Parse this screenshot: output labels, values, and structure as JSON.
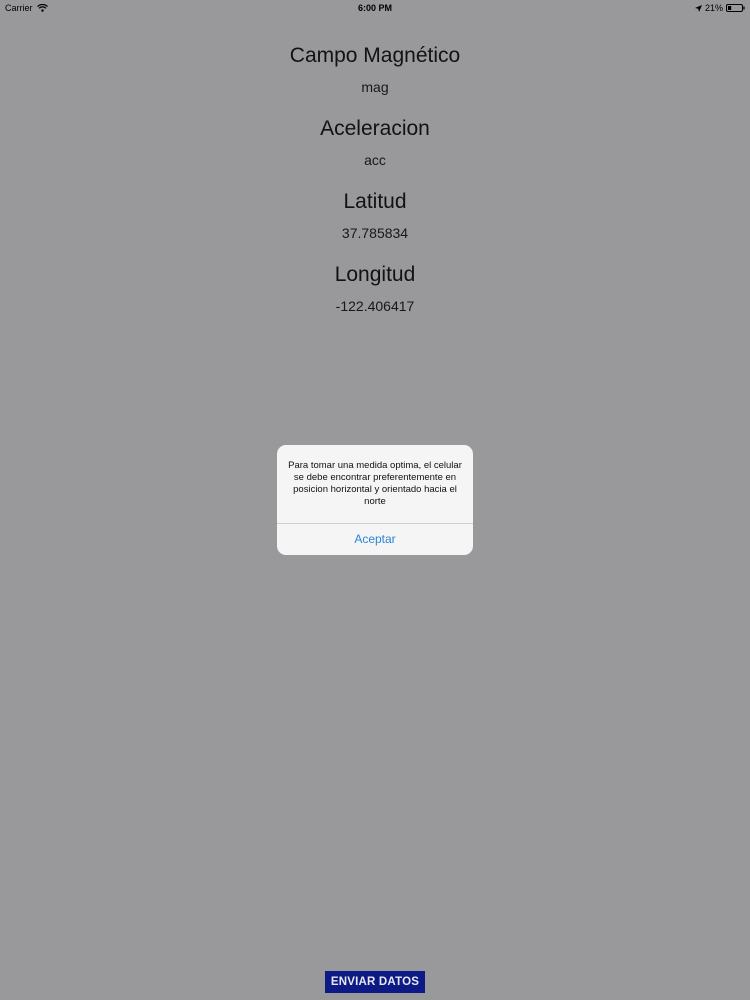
{
  "status_bar": {
    "carrier": "Carrier",
    "time": "6:00 PM",
    "battery_percent": "21%",
    "icons": [
      "wifi-icon",
      "location-icon",
      "battery-icon"
    ]
  },
  "fields": [
    {
      "title": "Campo Magnético",
      "value": "mag"
    },
    {
      "title": "Aceleracion",
      "value": "acc"
    },
    {
      "title": "Latitud",
      "value": "37.785834"
    },
    {
      "title": "Longitud",
      "value": "-122.406417"
    }
  ],
  "alert": {
    "message": "Para tomar una medida optima, el celular se debe encontrar preferentemente en posicion horizontal y orientado hacia el norte",
    "button_label": "Aceptar"
  },
  "send_button": {
    "label": "ENVIAR DATOS"
  },
  "colors": {
    "background_dimmed": "#99989b",
    "alert_background": "#f5f5f5",
    "alert_button": "#2b84d8",
    "send_button": "#0d1a86"
  }
}
